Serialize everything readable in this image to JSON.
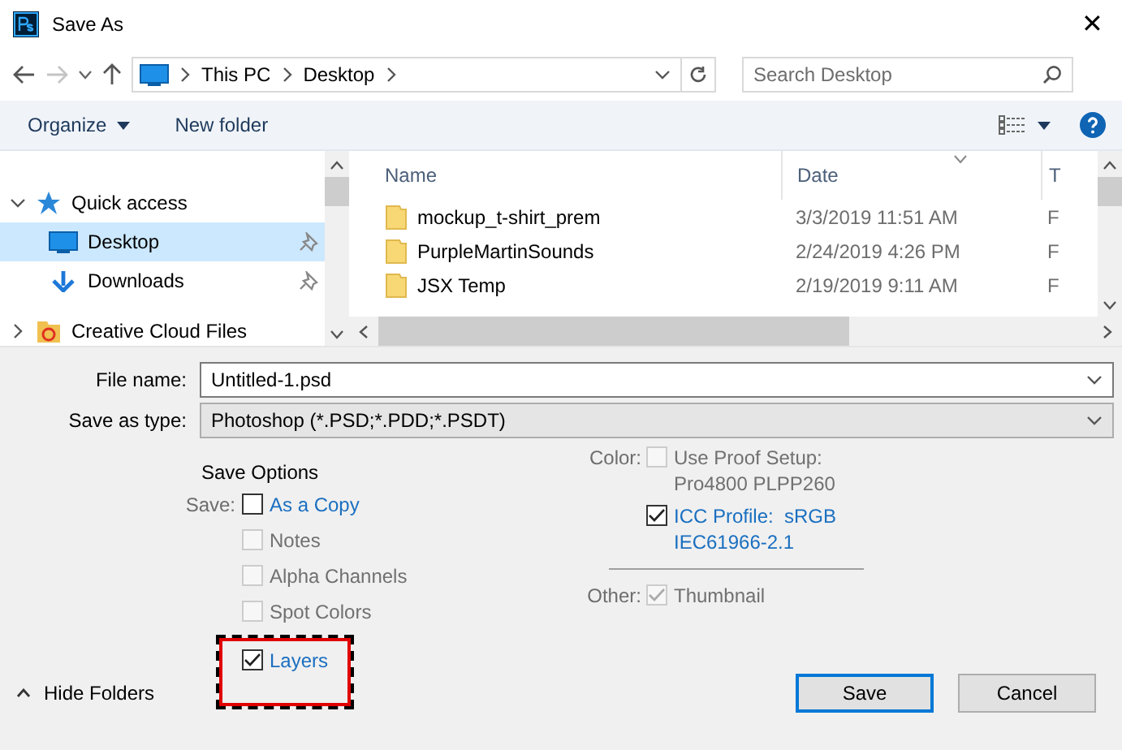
{
  "window": {
    "title": "Save As",
    "close": "✕"
  },
  "address": {
    "segments": [
      "This PC",
      "Desktop"
    ],
    "search_placeholder": "Search Desktop"
  },
  "toolbar": {
    "organize": "Organize",
    "new_folder": "New folder"
  },
  "navigation": [
    {
      "label": "Quick access",
      "expanded": true,
      "children": [
        {
          "label": "Desktop",
          "selected": true
        },
        {
          "label": "Downloads",
          "selected": false
        }
      ]
    },
    {
      "label": "Creative Cloud Files",
      "expanded": false
    }
  ],
  "files": {
    "columns": [
      "Name",
      "Date",
      "T"
    ],
    "rows": [
      {
        "name": "mockup_t-shirt_prem",
        "date": "3/3/2019 11:51 AM",
        "column_3": "F"
      },
      {
        "name": "PurpleMartinSounds",
        "date": "2/24/2019 4:26 PM",
        "column_3": "F"
      },
      {
        "name": "JSX Temp",
        "date": "2/19/2019 9:11 AM",
        "column_3": "F"
      }
    ]
  },
  "form": {
    "file_name_label": "File name:",
    "file_name": "Untitled-1.psd",
    "type_label": "Save as type:",
    "type": "Photoshop (*.PSD;*.PDD;*.PSDT)"
  },
  "save_options": {
    "heading": "Save Options",
    "save_label": "Save:",
    "items": [
      {
        "label": "As a Copy",
        "checked": false,
        "disabled": false,
        "highlighted": false
      },
      {
        "label": "Notes",
        "checked": false,
        "disabled": true,
        "highlighted": false
      },
      {
        "label": "Alpha Channels",
        "checked": false,
        "disabled": true,
        "highlighted": false
      },
      {
        "label": "Spot Colors",
        "checked": false,
        "disabled": true,
        "highlighted": false
      },
      {
        "label": "Layers",
        "checked": true,
        "disabled": false,
        "highlighted": true
      }
    ],
    "color_label": "Color:",
    "color_items": [
      {
        "label": "Use Proof Setup:\nPro4800 PLPP260",
        "checked": false,
        "disabled": true
      },
      {
        "label": "ICC Profile:  sRGB\nIEC61966-2.1",
        "checked": true,
        "disabled": false
      }
    ],
    "other_label": "Other:",
    "other_items": [
      {
        "label": "Thumbnail",
        "checked": true,
        "disabled": true
      }
    ]
  },
  "footer": {
    "hide_folders": "Hide Folders",
    "save": "Save",
    "cancel": "Cancel"
  }
}
